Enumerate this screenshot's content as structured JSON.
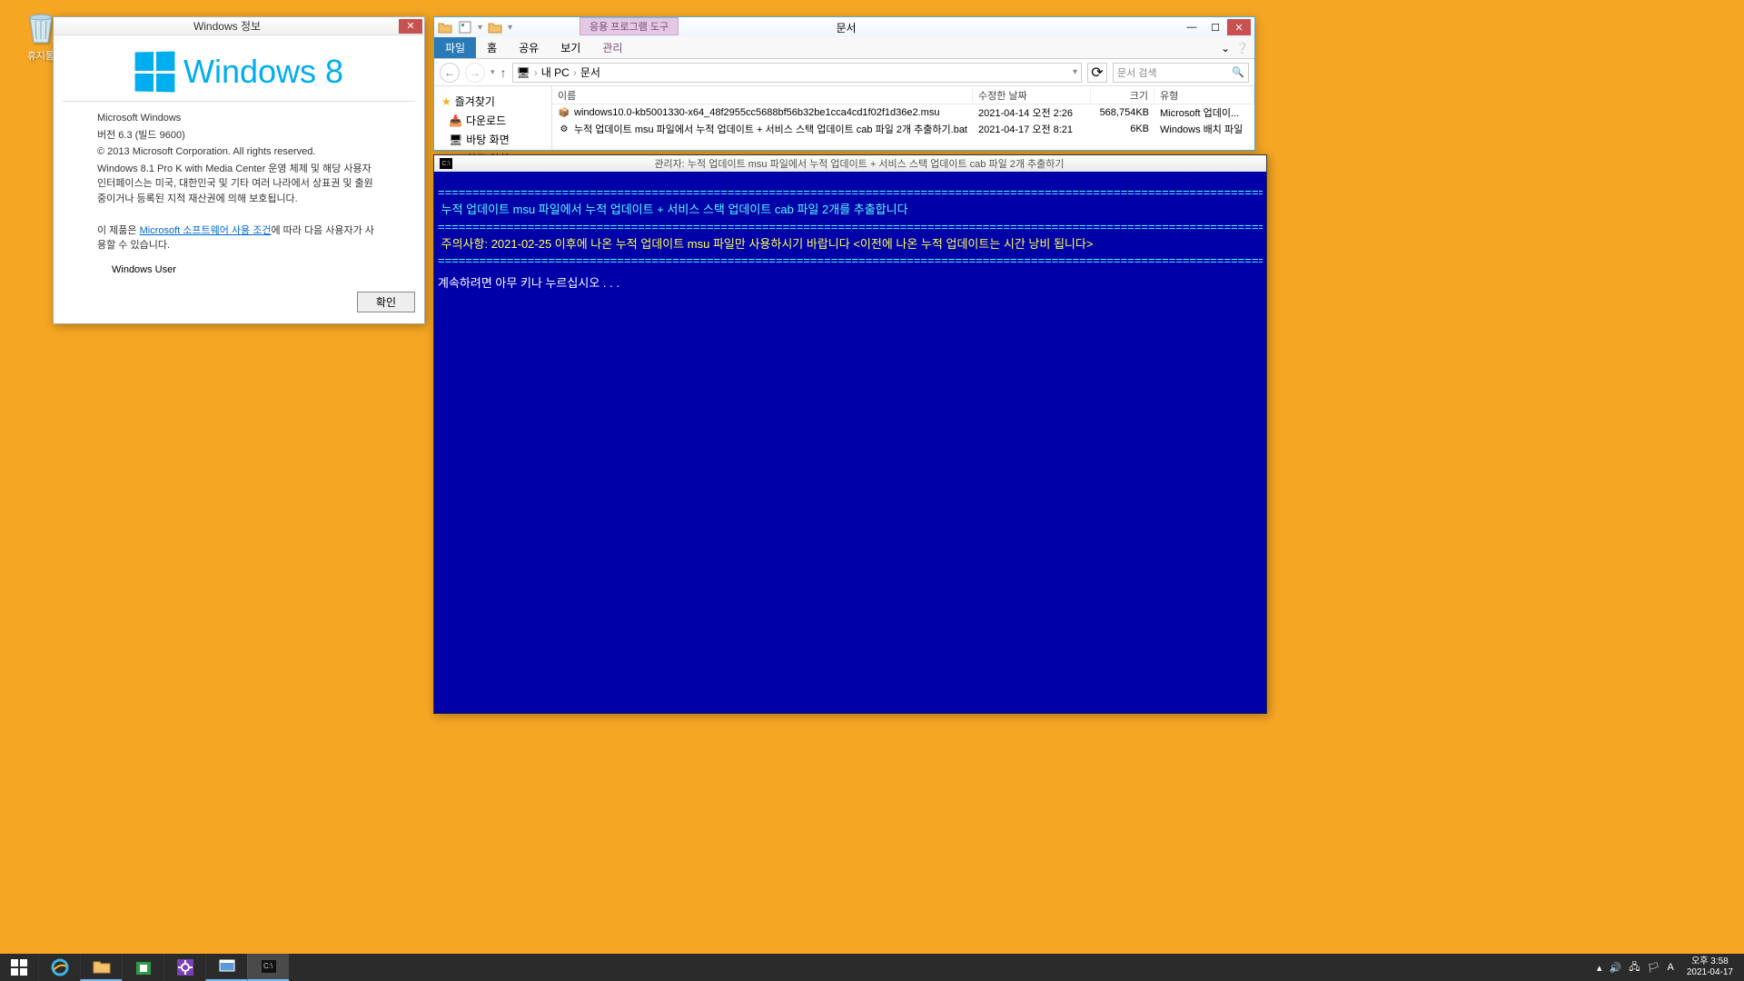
{
  "desktop": {
    "recycle_bin": "휴지통"
  },
  "winver": {
    "title": "Windows 정보",
    "logo_text": "Windows 8",
    "heading": "Microsoft Windows",
    "version": "버전 6.3 (빌드 9600)",
    "copyright": "© 2013 Microsoft Corporation. All rights reserved.",
    "edition": "Windows 8.1 Pro K with Media Center 운영 체제 및 해당 사용자 인터페이스는 미국, 대한민국 및 기타 여러 나라에서 상표권 및 출원 중이거나 등록된 지적 재산권에 의해 보호됩니다.",
    "license_prefix": "이 제품은 ",
    "license_link": "Microsoft 소프트웨어 사용 조건",
    "license_suffix": "에 따라 다음 사용자가 사용할 수 있습니다.",
    "user": "Windows User",
    "ok": "확인"
  },
  "explorer": {
    "doc_title": "문서",
    "tool_tab": "응용 프로그램 도구",
    "tabs": {
      "file": "파일",
      "home": "홈",
      "share": "공유",
      "view": "보기",
      "manage": "관리"
    },
    "breadcrumb": {
      "pc": "내 PC",
      "docs": "문서"
    },
    "search_placeholder": "문서 검색",
    "nav": {
      "favorites": "즐겨찾기",
      "downloads": "다운로드",
      "desktop": "바탕 화면",
      "recent": "최근 위치"
    },
    "columns": {
      "name": "이름",
      "date": "수정한 날짜",
      "size": "크기",
      "type": "유형"
    },
    "files": [
      {
        "name": "windows10.0-kb5001330-x64_48f2955cc5688bf56b32be1cca4cd1f02f1d36e2.msu",
        "date": "2021-04-14 오전 2:26",
        "size": "568,754KB",
        "type": "Microsoft 업데이..."
      },
      {
        "name": "누적 업데이트 msu 파일에서 누적 업데이트 + 서비스 스택 업데이트 cab 파일 2개 추출하기.bat",
        "date": "2021-04-17 오전 8:21",
        "size": "6KB",
        "type": "Windows 배치 파일"
      }
    ]
  },
  "cmd": {
    "title": "관리자:  누적 업데이트 msu 파일에서 누적 업데이트 + 서비스 스택 업데이트 cab 파일 2개 추출하기",
    "line1": " 누적 업데이트 msu 파일에서 누적 업데이트 + 서비스 스택 업데이트 cab 파일 2개를 추출합니다",
    "line2": " 주의사항: 2021-02-25 이후에 나온 누적 업데이트 msu 파일만 사용하시기 바랍니다 <이전에 나온 누적 업데이트는 시간 낭비 됩니다>",
    "prompt": "계속하려면 아무 키나 누르십시오 . . ."
  },
  "taskbar": {
    "ime": "A",
    "time": "오후 3:58",
    "date": "2021-04-17"
  }
}
